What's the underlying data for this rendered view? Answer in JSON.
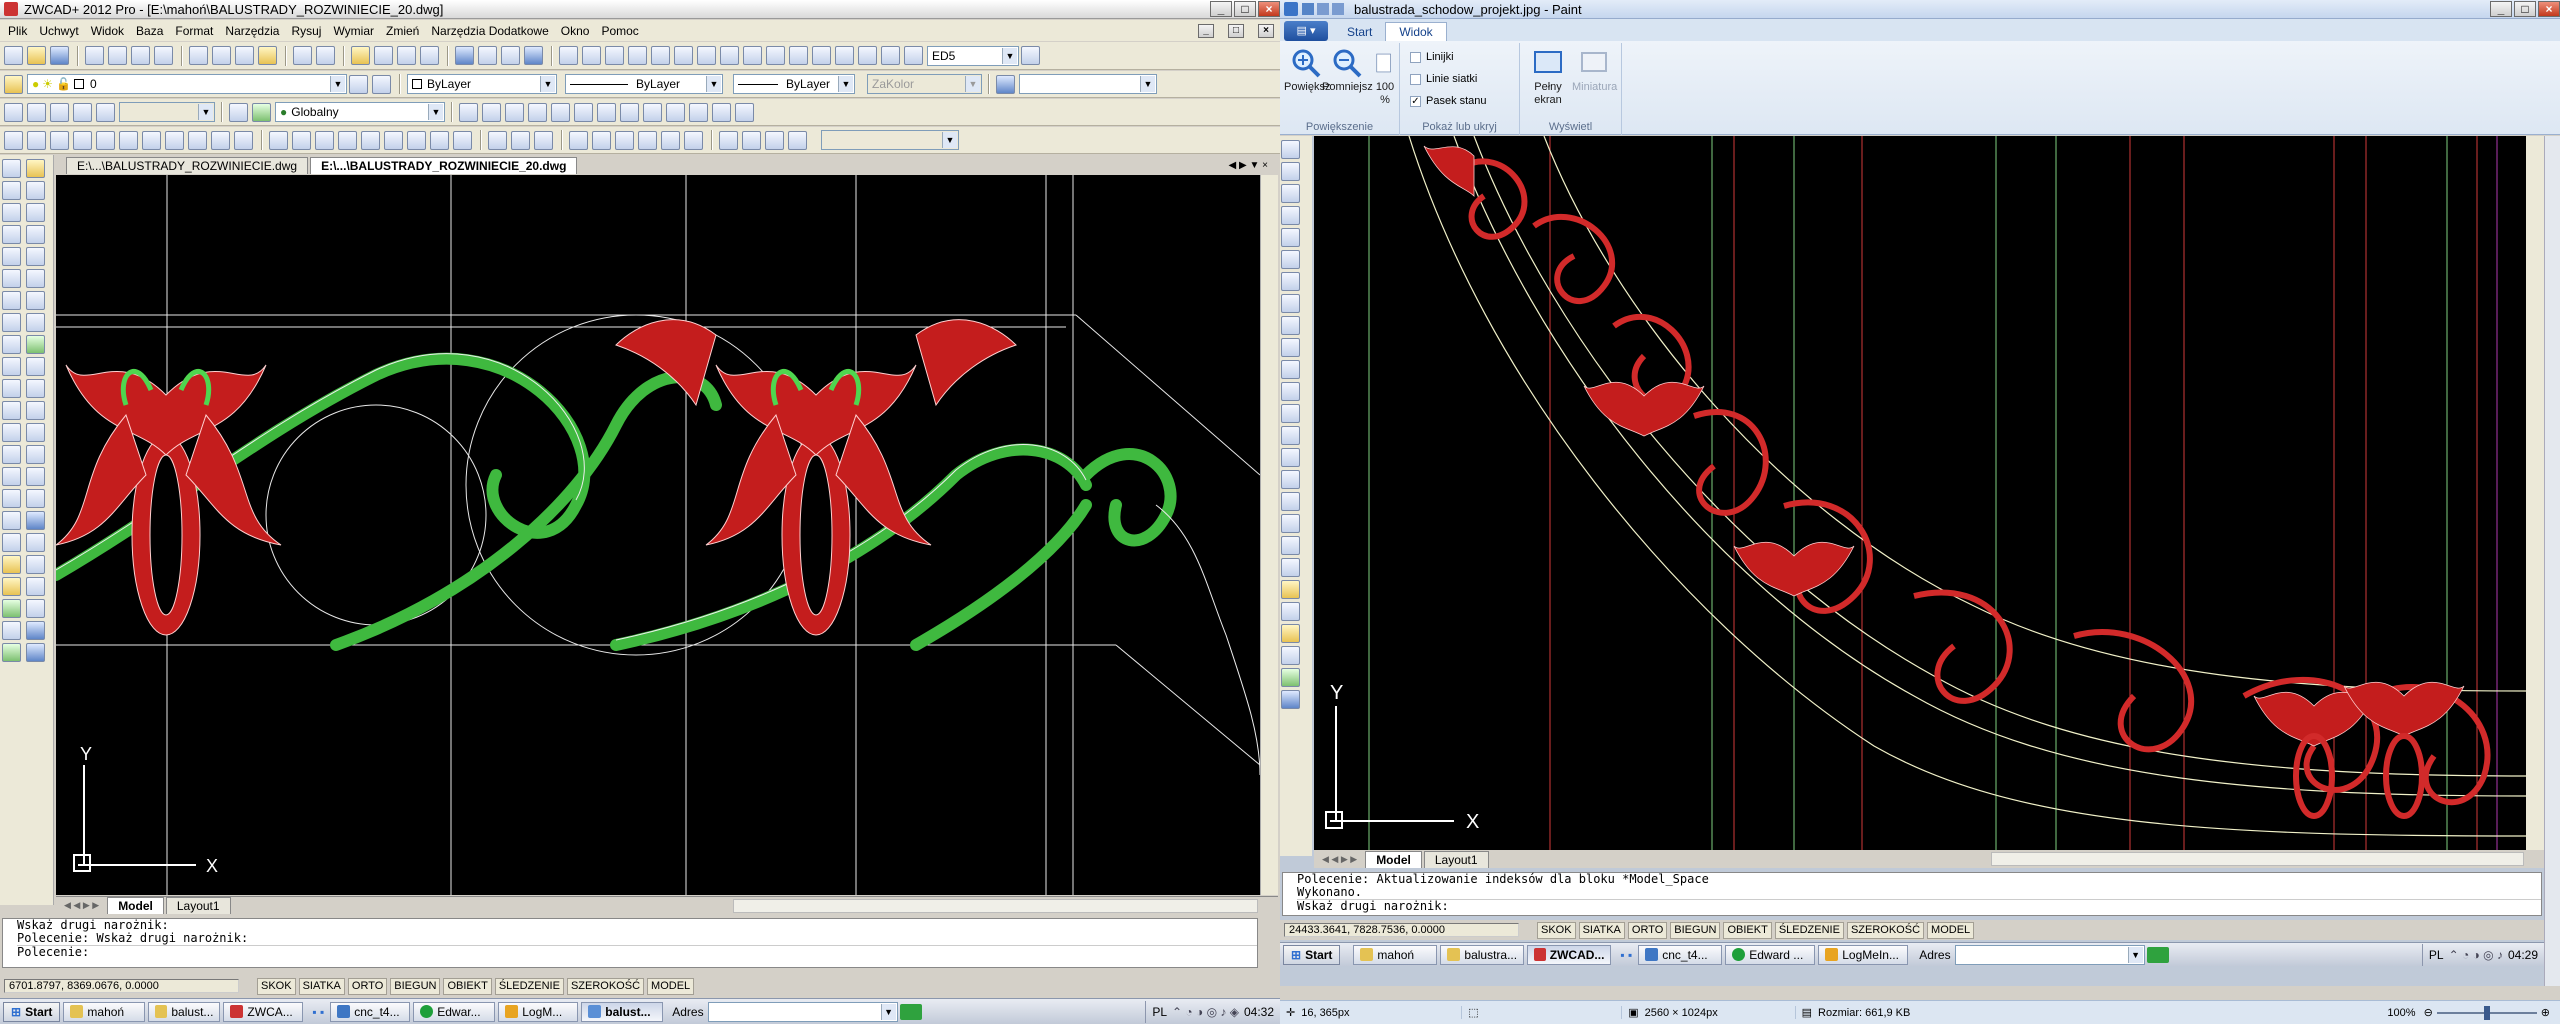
{
  "cad": {
    "title": "ZWCAD+ 2012 Pro - [E:\\mahoń\\BALUSTRADY_ROZWINIECIE_20.dwg]",
    "menu": [
      "Plik",
      "Uchwyt",
      "Widok",
      "Baza",
      "Format",
      "Narzędzia",
      "Rysuj",
      "Wymiar",
      "Zmień",
      "Narzędzia Dodatkowe",
      "Okno",
      "Pomoc"
    ],
    "style_combo": "ED5",
    "layer_combo": "0",
    "color_combo": "ByLayer",
    "linetype_combo": "ByLayer",
    "lineweight_combo": "ByLayer",
    "plotstyle_combo": "ZaKolor",
    "ucs_combo": "Globalny",
    "doc_tabs": [
      "E:\\...\\BALUSTRADY_ROZWINIECIE.dwg",
      "E:\\...\\BALUSTRADY_ROZWINIECIE_20.dwg"
    ],
    "layout_tabs": [
      "Model",
      "Layout1"
    ],
    "axis_x": "X",
    "axis_y": "Y",
    "command_lines": [
      "Wskaż drugi narożnik:",
      "Polecenie: Wskaż drugi narożnik:"
    ],
    "command_prompt": "Polecenie:",
    "coords": "6701.8797, 8369.0676, 0.0000",
    "status_buttons": [
      "SKOK",
      "SIATKA",
      "ORTO",
      "BIEGUN",
      "OBIEKT",
      "ŚLEDZENIE",
      "SZEROKOŚĆ",
      "MODEL"
    ]
  },
  "taskbar_left": {
    "start": "Start",
    "tasks": [
      "mahoń",
      "balust...",
      "ZWCA...",
      "cnc_t4...",
      "Edwar...",
      "LogM...",
      "balust..."
    ],
    "address_label": "Adres",
    "lang": "PL",
    "clock": "04:32"
  },
  "paint": {
    "title": "balustrada_schodow_projekt.jpg - Paint",
    "tabs": [
      "Start",
      "Widok"
    ],
    "zoom_in": "Powiększ",
    "zoom_out": "Pomniejsz",
    "zoom_100": "100 %",
    "group_zoom": "Powiększenie",
    "chk_rulers": "Linijki",
    "chk_grid": "Linie siatki",
    "chk_status": "Pasek stanu",
    "group_show": "Pokaż lub ukryj",
    "fullscreen": "Pełny ekran",
    "thumbnail": "Miniatura",
    "group_display": "Wyświetl",
    "inner_layout_tabs": [
      "Model",
      "Layout1"
    ],
    "inner_cmd": [
      "Polecenie: Aktualizowanie indeksów dla bloku *Model_Space",
      "Wykonano.",
      "Wskaż drugi narożnik:"
    ],
    "inner_coords": "24433.3641, 7828.7536, 0.0000",
    "inner_status": [
      "SKOK",
      "SIATKA",
      "ORTO",
      "BIEGUN",
      "OBIEKT",
      "ŚLEDZENIE",
      "SZEROKOŚĆ",
      "MODEL"
    ],
    "status_pos": "16, 365px",
    "status_dims": "2560 × 1024px",
    "status_size": "Rozmiar: 661,9 KB",
    "status_zoom": "100%"
  },
  "taskbar_right": {
    "start": "Start",
    "tasks": [
      "mahoń",
      "balustra...",
      "ZWCAD...",
      "cnc_t4...",
      "Edward ...",
      "LogMeIn..."
    ],
    "address_label": "Adres",
    "lang": "PL",
    "clock": "04:29"
  }
}
